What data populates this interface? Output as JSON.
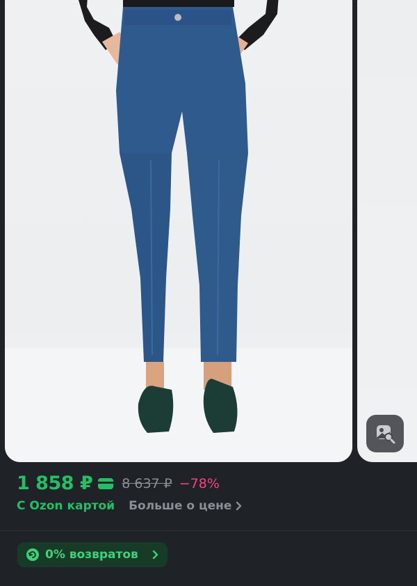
{
  "product": {
    "price_current": "1 858 ₽",
    "price_old": "8 637 ₽",
    "discount": "−78%",
    "ozon_card_label": "С Ozon картой",
    "more_price_label": "Больше о цене",
    "returns_label": "0% возвратов"
  },
  "colors": {
    "accent_green": "#21c064",
    "discount_pink": "#ff3f88",
    "muted_gray": "#8a8e95",
    "background": "#1f2227",
    "returns_badge_bg": "#173b27"
  },
  "icons": {
    "visual_search": "image-search-icon",
    "card": "ozon-card-icon",
    "more_price": "chevron-right-icon",
    "returns": "returns-icon"
  }
}
